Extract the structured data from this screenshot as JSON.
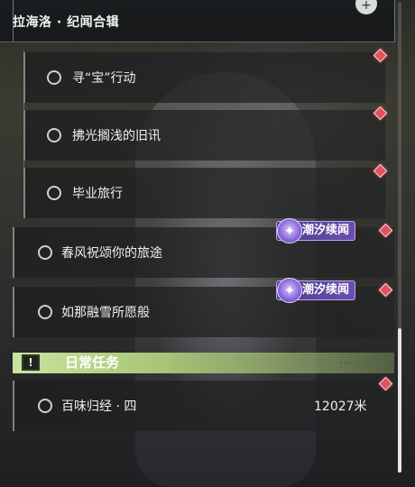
{
  "header": {
    "title": "拉海洛 · 纪闻合辑",
    "button_icon": "expand-icon"
  },
  "quests": [
    {
      "label": "寻“宝”行动",
      "tracked": true
    },
    {
      "label": "拂光搁浅的旧讯",
      "tracked": true
    },
    {
      "label": "毕业旅行",
      "tracked": true
    },
    {
      "label": "春风祝颂你的旅途",
      "tracked": true,
      "badge": "潮汐续闻"
    },
    {
      "label": "如那融雪所愿般",
      "tracked": true,
      "badge": "潮汐续闻"
    }
  ],
  "daily": {
    "section_title": "日常任务",
    "section_icon": "exclamation-icon",
    "items": [
      {
        "label": "百味归经 · 四",
        "distance": "12027米",
        "tracked": true
      }
    ]
  },
  "colors": {
    "marker": "#e0525f",
    "badge": "#6b4fb0",
    "section": "#c8e59e"
  }
}
